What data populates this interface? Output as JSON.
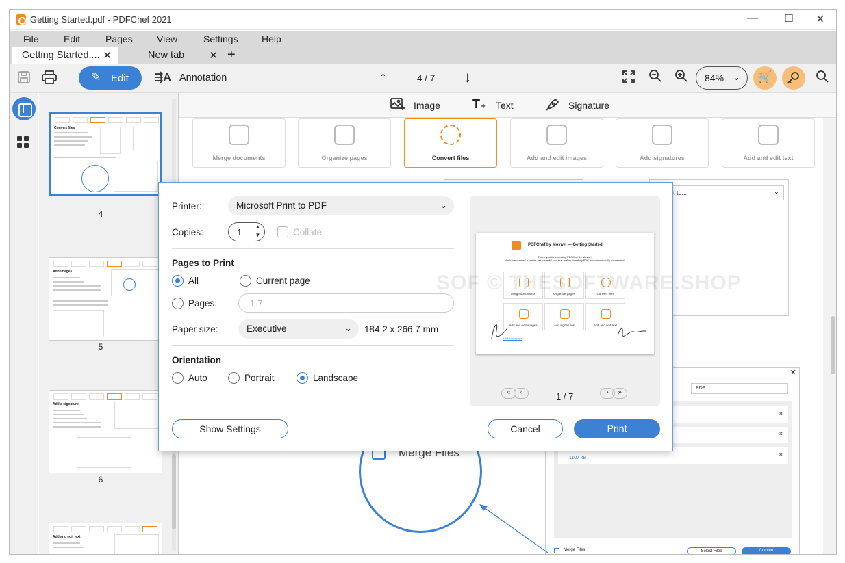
{
  "window": {
    "title": "Getting Started.pdf - PDFChef 2021"
  },
  "menu": [
    "File",
    "Edit",
    "Pages",
    "View",
    "Settings",
    "Help"
  ],
  "tabs": [
    {
      "label": "Getting Started...."
    },
    {
      "label": "New tab"
    }
  ],
  "toolbar": {
    "edit_label": "Edit",
    "annotation_label": "Annotation",
    "page_indicator": "4 / 7",
    "zoom": "84%"
  },
  "subtoolbar": {
    "image": "Image",
    "text": "Text",
    "signature": "Signature"
  },
  "thumbnails": [
    {
      "number": "4",
      "heading": "Convert files"
    },
    {
      "number": "5",
      "heading": "Add images"
    },
    {
      "number": "6",
      "heading": "Add a signature"
    },
    {
      "number": "",
      "heading": "Add and edit text"
    }
  ],
  "doc": {
    "cards": [
      "Merge documents",
      "Organize pages",
      "Convert files",
      "Add and edit images",
      "Add signatures",
      "Add and edit text"
    ],
    "merge_files": "Merge Files",
    "mock_select": "rt to...",
    "mock_input": "PDF",
    "mock_size": "1107 kB",
    "mock_merge": "Merge Files",
    "mock_select_files": "Select Files",
    "mock_convert": "Convert"
  },
  "print_dialog": {
    "printer_label": "Printer:",
    "printer_value": "Microsoft Print to PDF",
    "copies_label": "Copies:",
    "copies_value": "1",
    "collate_label": "Collate",
    "pages_heading": "Pages to Print",
    "all_label": "All",
    "current_label": "Current page",
    "pages_label": "Pages:",
    "pages_placeholder": "1-7",
    "paper_label": "Paper size:",
    "paper_value": "Executive",
    "paper_dims": "184.2 x 266.7 mm",
    "orientation_heading": "Orientation",
    "auto_label": "Auto",
    "portrait_label": "Portrait",
    "landscape_label": "Landscape",
    "show_settings": "Show Settings",
    "cancel": "Cancel",
    "print": "Print",
    "preview_page": "1 / 7",
    "preview_title": "PDFChef by Movavi — Getting Started",
    "preview_sub1": "Thank you for choosing PDFChef by Movavi!",
    "preview_sub2": "We have created a simple yet powerful tool that makes handling PDF documents really convenient.",
    "preview_cells": [
      "Merge documents",
      "Organize pages",
      "Convert files",
      "Add and edit images",
      "Add signatures",
      "Add and edit text"
    ],
    "preview_link": "Visit homepage"
  },
  "watermark": "SOF © THESOFTWARE.SHOP",
  "colors": {
    "accent": "#3b82d6",
    "brand": "#f28c22"
  }
}
